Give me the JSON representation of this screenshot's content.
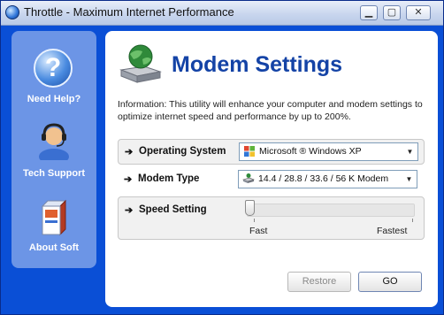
{
  "window": {
    "title": "Throttle - Maximum Internet Performance",
    "controls": {
      "minimize": "▁",
      "maximize": "▢",
      "close": "✕"
    }
  },
  "sidebar": {
    "items": [
      {
        "label": "Need Help?",
        "icon": "question-icon"
      },
      {
        "label": "Tech Support",
        "icon": "headset-support-icon"
      },
      {
        "label": "About Soft",
        "icon": "software-box-icon"
      }
    ]
  },
  "main": {
    "title": "Modem Settings",
    "info": "Information: This utility will enhance your computer and modem settings to optimize internet speed and performance by up to 200%.",
    "operating_system": {
      "arrow": "➔",
      "label": "Operating System",
      "value": "Microsoft ® Windows XP",
      "icon": "windows-logo-icon"
    },
    "modem_type": {
      "arrow": "➔",
      "label": "Modem Type",
      "value": "14.4 / 28.8 / 33.6 / 56 K Modem",
      "icon": "modem-icon"
    },
    "speed_setting": {
      "arrow": "➔",
      "label": "Speed Setting",
      "min_label": "Fast",
      "max_label": "Fastest",
      "value_fraction": 0.0
    },
    "buttons": {
      "restore": "Restore",
      "go": "GO"
    }
  },
  "colors": {
    "window_blue": "#0a4fd6",
    "sidebar_blue": "#6c95e6",
    "title_blue": "#1443a6"
  }
}
